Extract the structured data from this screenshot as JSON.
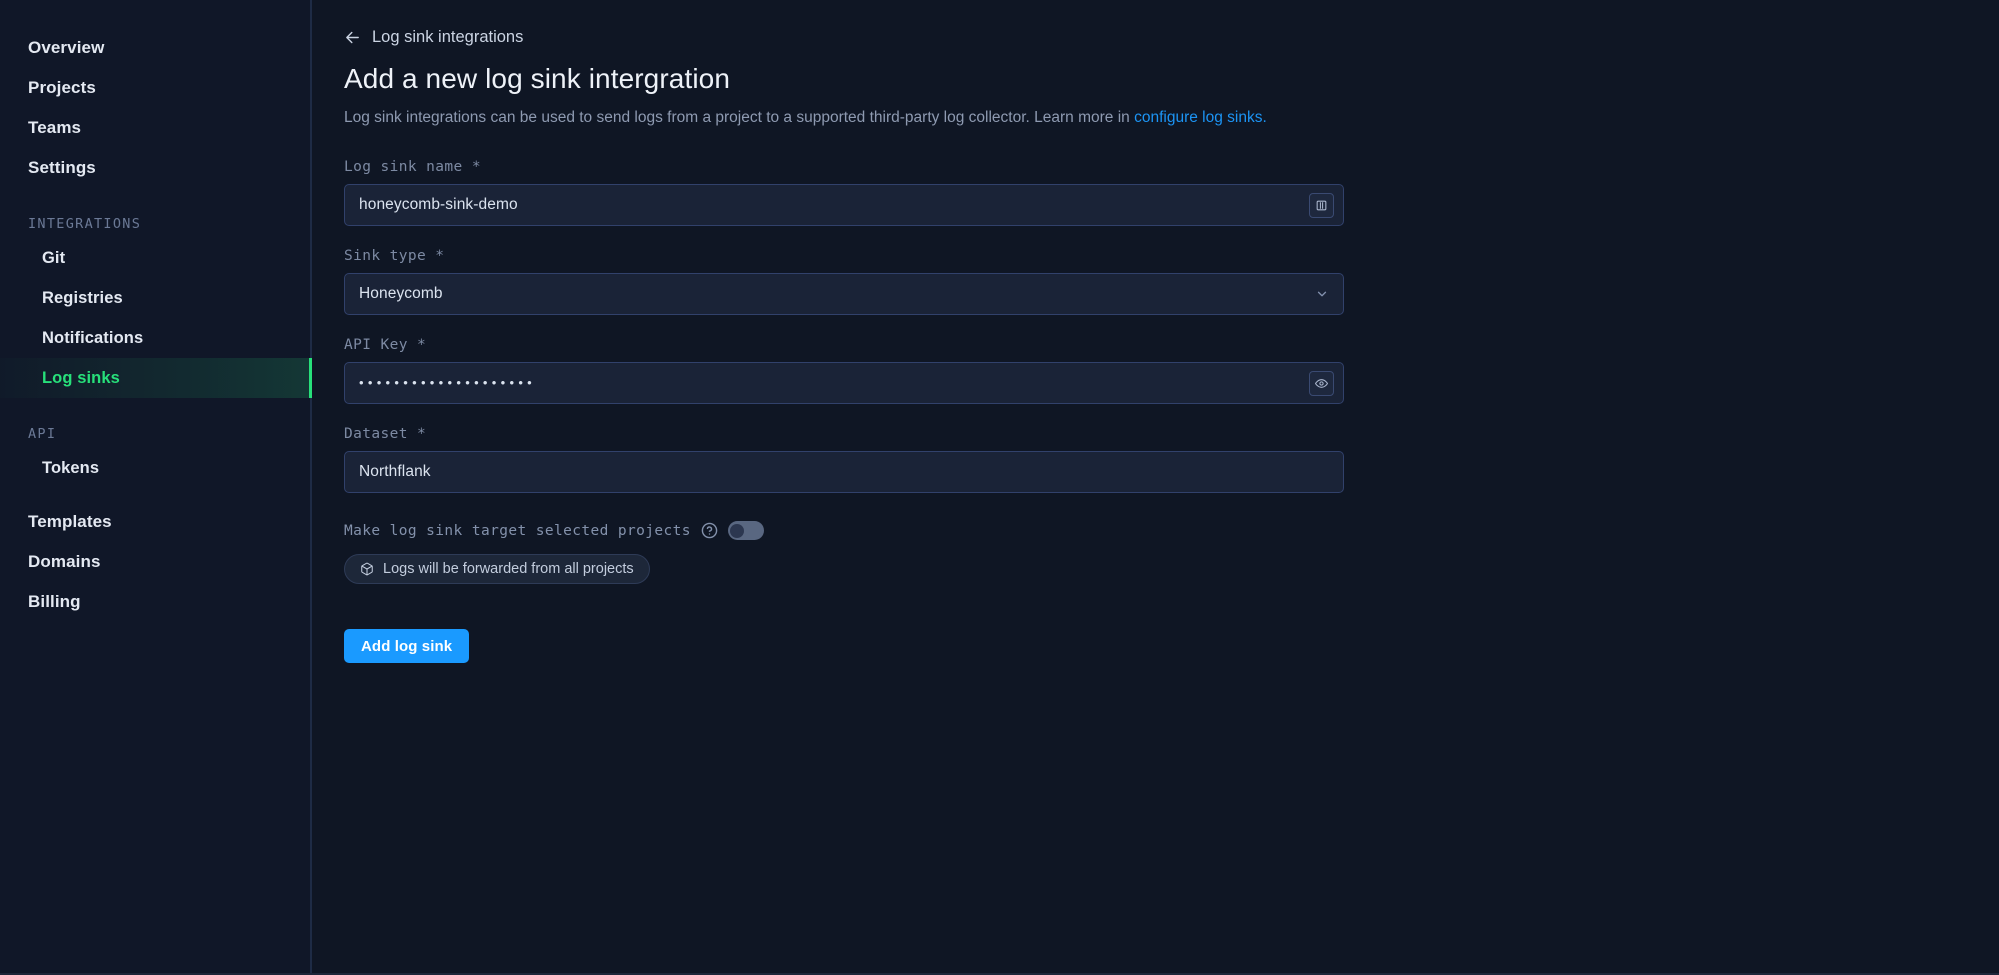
{
  "sidebar": {
    "items": [
      {
        "label": "Overview",
        "type": "top",
        "active": false
      },
      {
        "label": "Projects",
        "type": "top",
        "active": false
      },
      {
        "label": "Teams",
        "type": "top",
        "active": false
      },
      {
        "label": "Settings",
        "type": "top",
        "active": false
      }
    ],
    "section_integrations": "INTEGRATIONS",
    "integrations": [
      {
        "label": "Git",
        "active": false
      },
      {
        "label": "Registries",
        "active": false
      },
      {
        "label": "Notifications",
        "active": false
      },
      {
        "label": "Log sinks",
        "active": true
      }
    ],
    "section_api": "API",
    "api": [
      {
        "label": "Tokens",
        "active": false
      }
    ],
    "bottom": [
      {
        "label": "Templates",
        "active": false
      },
      {
        "label": "Domains",
        "active": false
      },
      {
        "label": "Billing",
        "active": false
      }
    ],
    "accent_color": "#27e07a"
  },
  "header": {
    "breadcrumb": "Log sink integrations",
    "back_icon": "arrow-left-icon",
    "title": "Add a new log sink intergration",
    "description_before": "Log sink integrations can be used to send logs from a project to a supported third-party log collector. Learn more in ",
    "description_link": "configure log sinks.",
    "link_color": "#1c94f4"
  },
  "form": {
    "name": {
      "label": "Log sink name *",
      "value": "honeycomb-sink-demo",
      "placeholder": "Log sink name",
      "action_icon": "randomize-name-icon"
    },
    "sink_type": {
      "label": "Sink type *",
      "value": "Honeycomb",
      "options": [
        "Honeycomb"
      ],
      "chevron_icon": "chevron-down-icon"
    },
    "api_key": {
      "label": "API Key *",
      "value": "••••••••••••••••••••",
      "placeholder": "API Key",
      "action_icon": "eye-icon"
    },
    "dataset": {
      "label": "Dataset *",
      "value": "Northflank",
      "placeholder": "Dataset"
    },
    "target_toggle": {
      "label": "Make log sink target selected projects",
      "help_icon": "question-circle-icon",
      "enabled": false
    },
    "badge": {
      "icon": "box-icon",
      "text": "Logs will be forwarded from all projects"
    },
    "submit_label": "Add log sink",
    "submit_color": "#1a9aff"
  }
}
